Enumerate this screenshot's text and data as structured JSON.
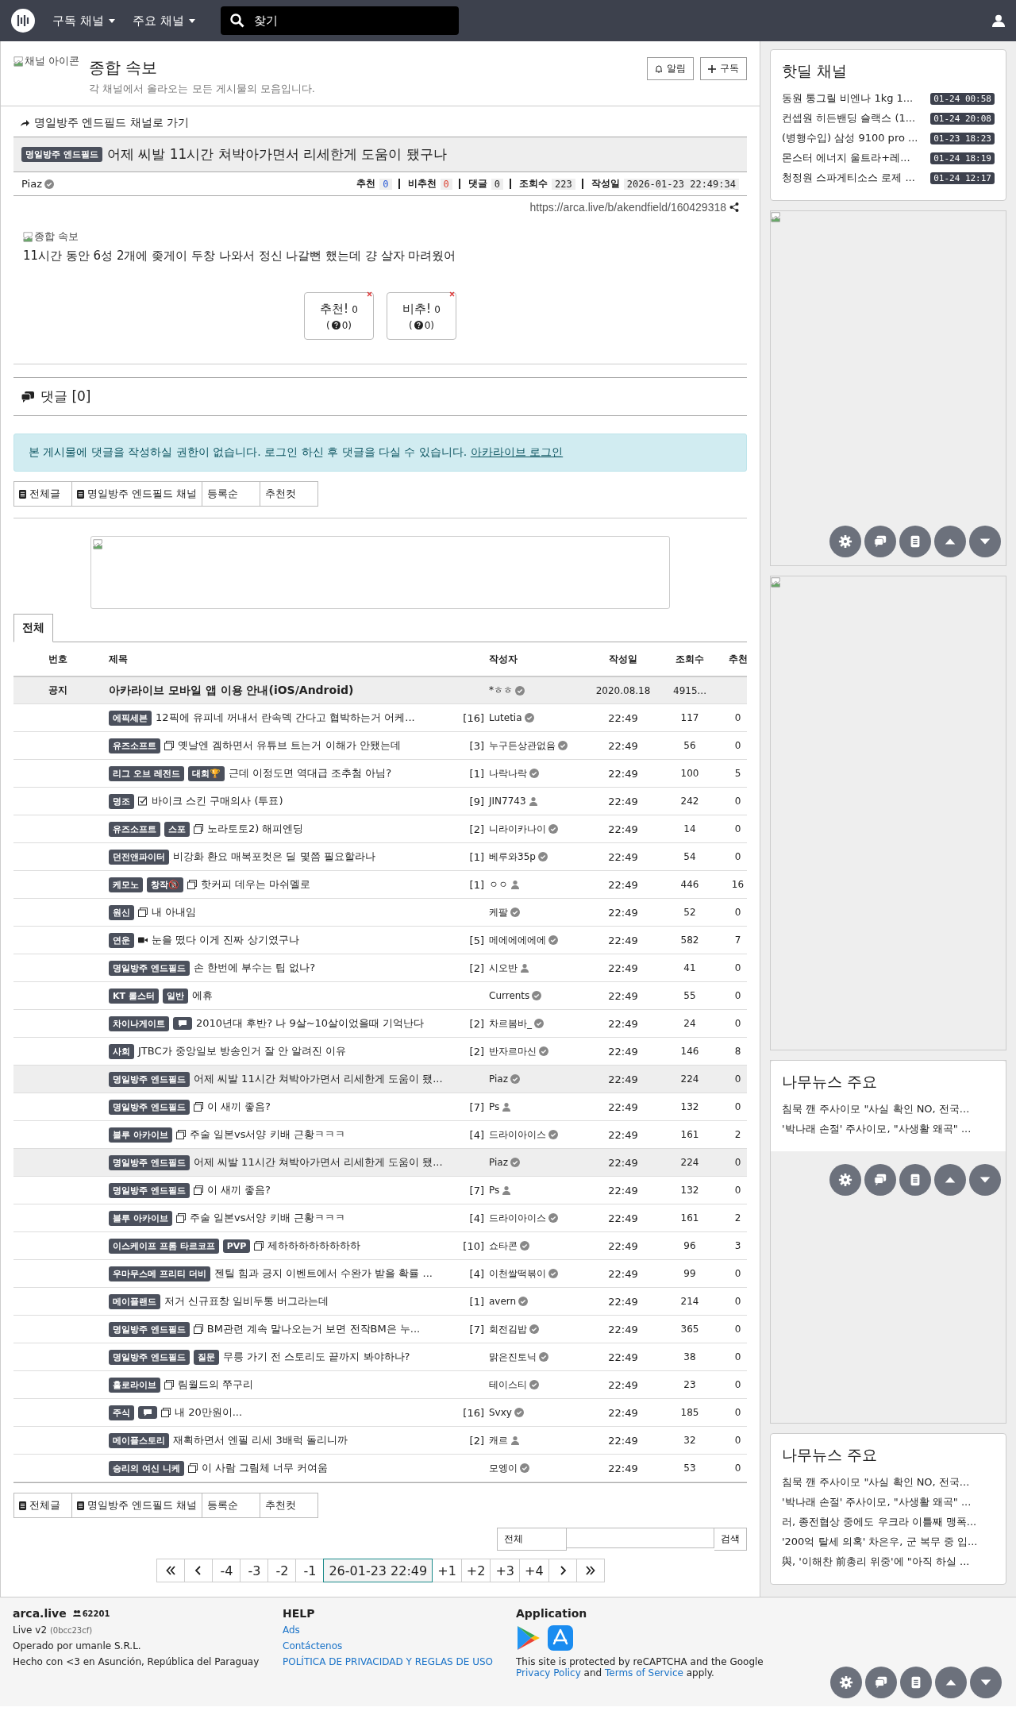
{
  "nav": {
    "menus": [
      "구독 채널",
      "주요 채널"
    ],
    "search": {
      "placeholder": "찾기"
    }
  },
  "channel": {
    "icon_alt": "채널 아이콘",
    "title": "종합 속보",
    "description": "각 채널에서 올라오는 모든 게시물의 모음입니다.",
    "buttons": [
      "알림",
      "구독"
    ]
  },
  "post": {
    "back_link": "명일방주 엔드필드 채널로 가기",
    "category": "명일방주 엔드필드",
    "title": "어제 씨발 11시간 쳐박아가면서 리세한게 도움이 됐구나",
    "author": "Piaz",
    "stats": [
      {
        "label": "추천",
        "value": "0",
        "kind": "up"
      },
      {
        "label": "비추천",
        "value": "0",
        "kind": "down"
      },
      {
        "label": "댓글",
        "value": "0",
        "kind": "plain"
      },
      {
        "label": "조회수",
        "value": "223",
        "kind": "plain"
      },
      {
        "label": "작성일",
        "value": "2026-01-23 22:49:34",
        "kind": "plain"
      }
    ],
    "url": "https://arca.live/b/akendfield/160429318",
    "image_alt": "종합 속보",
    "body": "11시간 동안 6성 2개에 좆게이 두창 나와서 정신 나갈뻔 했는데 걍 살자 마려웠어",
    "votes": [
      {
        "label": "추천!",
        "count": "0",
        "sub_open": "(",
        "sub": "0)"
      },
      {
        "label": "비추!",
        "count": "0",
        "sub_open": "(",
        "sub": "0)"
      }
    ]
  },
  "comments": {
    "title": "댓글 [0]",
    "notice": "본 게시물에 댓글을 작성하실 권한이 없습니다. 로그인 하신 후 댓글을 다실 수 있습니다.",
    "login_link": "아카라이브 로그인"
  },
  "filters_top": [
    {
      "label": "전체글",
      "kind": "board"
    },
    {
      "label": "명일방주 엔드필드 채널",
      "kind": "board"
    },
    {
      "label": "등록순",
      "kind": "sort"
    },
    {
      "label": "추천컷",
      "kind": "sort"
    }
  ],
  "tabs": [
    {
      "label": "전체",
      "selected": true
    }
  ],
  "table": {
    "columns": [
      "번호",
      "제목",
      "작성자",
      "작성일",
      "조회수",
      "추천"
    ],
    "notice": {
      "number": "공지",
      "title": "아카라이브 모바일 앱 이용 안내(iOS/Android)",
      "author": "*ㅎㅎ",
      "date": "2020.08.18",
      "views": "4915..."
    },
    "rows": [
      {
        "badges": [
          {
            "kind": "text",
            "text": "에픽세븐"
          }
        ],
        "kind": "plain",
        "title": "12픽에 유피네 꺼내서 란속덱 간다고 협박하는거 어케...",
        "comments": "[16]",
        "author": "Lutetia",
        "verified": true,
        "date": "22:49",
        "views": "117",
        "votes": "0",
        "current": false
      },
      {
        "badges": [
          {
            "kind": "text",
            "text": "유즈소프트"
          }
        ],
        "kind": "image",
        "title": "옛날엔 겜하면서 유튜브 트는거 이해가 안됐는데",
        "comments": "[3]",
        "author": "누구든상관없음",
        "verified": true,
        "date": "22:49",
        "views": "56",
        "votes": "0",
        "current": false
      },
      {
        "badges": [
          {
            "kind": "text",
            "text": "리그 오브 레전드"
          },
          {
            "kind": "text",
            "text": "대회🏆"
          }
        ],
        "kind": "plain",
        "title": "근데 이정도면 역대급 조추첨 아님?",
        "comments": "[1]",
        "author": "나락나락",
        "verified": true,
        "date": "22:49",
        "views": "100",
        "votes": "5",
        "current": false
      },
      {
        "badges": [
          {
            "kind": "text",
            "text": "명조"
          }
        ],
        "kind": "poll",
        "title": "바이크 스킨 구매의사 (투표)",
        "comments": "[9]",
        "author": "JIN7743",
        "verified": false,
        "date": "22:49",
        "views": "242",
        "votes": "0",
        "current": false
      },
      {
        "badges": [
          {
            "kind": "text",
            "text": "유즈소프트"
          },
          {
            "kind": "text",
            "text": "스포"
          }
        ],
        "kind": "image",
        "title": "노라토토2) 해피엔딩",
        "comments": "[2]",
        "author": "니라이카나이",
        "verified": true,
        "date": "22:49",
        "views": "14",
        "votes": "0",
        "current": false
      },
      {
        "badges": [
          {
            "kind": "text",
            "text": "던전앤파이터"
          }
        ],
        "kind": "plain",
        "title": "비강화 환요 매복포컷은 딜 몇쯤 필요할라나",
        "comments": "[1]",
        "author": "베루와35p",
        "verified": true,
        "date": "22:49",
        "views": "54",
        "votes": "0",
        "current": false
      },
      {
        "badges": [
          {
            "kind": "text",
            "text": "케모노"
          },
          {
            "kind": "text",
            "text": "창작🔞"
          }
        ],
        "kind": "image",
        "title": "핫커피 데우는 마쉬멜로",
        "comments": "[1]",
        "author": "ㅇㅇ",
        "verified": false,
        "date": "22:49",
        "views": "446",
        "votes": "16",
        "current": false
      },
      {
        "badges": [
          {
            "kind": "text",
            "text": "원신"
          }
        ],
        "kind": "image",
        "title": "내 아내임",
        "author": "케팔",
        "verified": true,
        "date": "22:49",
        "views": "52",
        "votes": "0",
        "current": false
      },
      {
        "badges": [
          {
            "kind": "text",
            "text": "연운"
          }
        ],
        "kind": "video",
        "title": "눈을 떴다 이게 진짜 상기였구나",
        "comments": "[5]",
        "author": "메에에에에에",
        "verified": true,
        "date": "22:49",
        "views": "582",
        "votes": "7",
        "current": false
      },
      {
        "badges": [
          {
            "kind": "text",
            "text": "명일방주 엔드필드"
          }
        ],
        "kind": "plain",
        "title": "손 한번에 부수는 팁 없나?",
        "comments": "[2]",
        "author": "시오반",
        "verified": false,
        "date": "22:49",
        "views": "41",
        "votes": "0",
        "current": false
      },
      {
        "badges": [
          {
            "kind": "text",
            "text": "KT 롤스터"
          },
          {
            "kind": "text",
            "text": "일반"
          }
        ],
        "kind": "plain",
        "title": "에휴",
        "author": "Currents",
        "verified": true,
        "date": "22:49",
        "views": "55",
        "votes": "0",
        "current": false
      },
      {
        "badges": [
          {
            "kind": "text",
            "text": "차이나게이트"
          },
          {
            "kind": "chat"
          }
        ],
        "kind": "plain",
        "title": "2010년대 후반? 나 9살~10살이었을때 기억난다",
        "comments": "[2]",
        "author": "차르봄바_",
        "verified": true,
        "date": "22:49",
        "views": "24",
        "votes": "0",
        "current": false
      },
      {
        "badges": [
          {
            "kind": "text",
            "text": "사회"
          }
        ],
        "kind": "plain",
        "title": "JTBC가 중앙일보 방송인거 잘 안 알려진 이유",
        "comments": "[2]",
        "author": "반자르마신",
        "verified": true,
        "date": "22:49",
        "views": "146",
        "votes": "8",
        "current": false
      },
      {
        "badges": [
          {
            "kind": "text",
            "text": "명일방주 엔드필드"
          }
        ],
        "kind": "plain",
        "title": "어제 씨발 11시간 쳐박아가면서 리세한게 도움이 됐...",
        "author": "Piaz",
        "verified": true,
        "date": "22:49",
        "views": "224",
        "votes": "0",
        "current": true
      },
      {
        "badges": [
          {
            "kind": "text",
            "text": "명일방주 엔드필드"
          }
        ],
        "kind": "image",
        "title": "이 새끼 좋음?",
        "comments": "[7]",
        "author": "Ps",
        "verified": false,
        "date": "22:49",
        "views": "132",
        "votes": "0",
        "current": false
      },
      {
        "badges": [
          {
            "kind": "text",
            "text": "블루 아카이브"
          }
        ],
        "kind": "image",
        "title": "주술 일본vs서양 키배 근황ㅋㅋㅋ",
        "comments": "[4]",
        "author": "드라이아이스",
        "verified": true,
        "date": "22:49",
        "views": "161",
        "votes": "2",
        "current": false
      },
      {
        "badges": [
          {
            "kind": "text",
            "text": "명일방주 엔드필드"
          }
        ],
        "kind": "plain",
        "title": "어제 씨발 11시간 쳐박아가면서 리세한게 도움이 됐...",
        "author": "Piaz",
        "verified": true,
        "date": "22:49",
        "views": "224",
        "votes": "0",
        "current": true
      },
      {
        "badges": [
          {
            "kind": "text",
            "text": "명일방주 엔드필드"
          }
        ],
        "kind": "image",
        "title": "이 새끼 좋음?",
        "comments": "[7]",
        "author": "Ps",
        "verified": false,
        "date": "22:49",
        "views": "132",
        "votes": "0",
        "current": false
      },
      {
        "badges": [
          {
            "kind": "text",
            "text": "블루 아카이브"
          }
        ],
        "kind": "image",
        "title": "주술 일본vs서양 키배 근황ㅋㅋㅋ",
        "comments": "[4]",
        "author": "드라이아이스",
        "verified": true,
        "date": "22:49",
        "views": "161",
        "votes": "2",
        "current": false
      },
      {
        "badges": [
          {
            "kind": "text",
            "text": "이스케이프 프롬 타르코프"
          },
          {
            "kind": "text",
            "text": "PVP"
          }
        ],
        "kind": "image",
        "title": "제하하하하하하하하",
        "comments": "[10]",
        "author": "쇼타콘",
        "verified": true,
        "date": "22:49",
        "views": "96",
        "votes": "3",
        "current": false
      },
      {
        "badges": [
          {
            "kind": "text",
            "text": "우마무스메 프리티 더비"
          }
        ],
        "kind": "plain",
        "title": "젠틸 힘과 긍지 이벤트에서 수완가 받을 확률 ...",
        "comments": "[4]",
        "author": "이천쌀떡볶이",
        "verified": true,
        "date": "22:49",
        "views": "99",
        "votes": "0",
        "current": false
      },
      {
        "badges": [
          {
            "kind": "text",
            "text": "메이플랜드"
          }
        ],
        "kind": "plain",
        "title": "저거 신규표창 일비두통 버그라는데",
        "comments": "[1]",
        "author": "avern",
        "verified": true,
        "date": "22:49",
        "views": "214",
        "votes": "0",
        "current": false
      },
      {
        "badges": [
          {
            "kind": "text",
            "text": "명일방주 엔드필드"
          }
        ],
        "kind": "image",
        "title": "BM관련 계속 말나오는거 보면 전작BM은 누...",
        "comments": "[7]",
        "author": "회전김밥",
        "verified": true,
        "date": "22:49",
        "views": "365",
        "votes": "0",
        "current": false
      },
      {
        "badges": [
          {
            "kind": "text",
            "text": "명일방주 엔드필드"
          },
          {
            "kind": "text",
            "text": "질문"
          }
        ],
        "kind": "plain",
        "title": "무릉 가기 전 스토리도 끝까지 봐야하나?",
        "author": "맑은진토닉",
        "verified": true,
        "date": "22:49",
        "views": "38",
        "votes": "0",
        "current": false
      },
      {
        "badges": [
          {
            "kind": "text",
            "text": "홀로라이브"
          }
        ],
        "kind": "image",
        "title": "림월드의 쭈구리",
        "author": "테이스티",
        "verified": true,
        "date": "22:49",
        "views": "23",
        "votes": "0",
        "current": false
      },
      {
        "badges": [
          {
            "kind": "text",
            "text": "주식"
          },
          {
            "kind": "chat"
          }
        ],
        "kind": "image",
        "title": "내 20만원이...",
        "comments": "[16]",
        "author": "Svxy",
        "verified": true,
        "date": "22:49",
        "views": "185",
        "votes": "0",
        "current": false
      },
      {
        "badges": [
          {
            "kind": "text",
            "text": "메이플스토리"
          }
        ],
        "kind": "plain",
        "title": "재획하면서 엔필 리세 3배럭 돌리니까",
        "comments": "[2]",
        "author": "캐르",
        "verified": false,
        "date": "22:49",
        "views": "32",
        "votes": "0",
        "current": false
      },
      {
        "badges": [
          {
            "kind": "text",
            "text": "승리의 여신 니케"
          }
        ],
        "kind": "image",
        "title": "이 사람 그림체 너무 커여움",
        "author": "모엥이",
        "verified": true,
        "date": "22:49",
        "views": "53",
        "votes": "0",
        "current": false
      }
    ]
  },
  "filters_bottom": [
    {
      "label": "전체글",
      "kind": "board"
    },
    {
      "label": "명일방주 엔드필드 채널",
      "kind": "board"
    },
    {
      "label": "등록순",
      "kind": "sort"
    },
    {
      "label": "추천컷",
      "kind": "sort"
    }
  ],
  "search": {
    "scope": "전체",
    "button": "검색"
  },
  "pagination": [
    {
      "label": "-4",
      "selected": false
    },
    {
      "label": "-3",
      "selected": false
    },
    {
      "label": "-2",
      "selected": false
    },
    {
      "label": "-1",
      "selected": false
    },
    {
      "label": "26-01-23 22:49",
      "selected": true
    },
    {
      "label": "+1",
      "selected": false
    },
    {
      "label": "+2",
      "selected": false
    },
    {
      "label": "+3",
      "selected": false
    },
    {
      "label": "+4",
      "selected": false
    }
  ],
  "sidebar": {
    "hotdeal": {
      "title": "핫딜 채널",
      "items": [
        {
          "text": "동원 통그릴 비엔나 1kg 1...",
          "time": "01-24 00:58"
        },
        {
          "text": "컨셉원 히든밴딩 슬랙스 (1...",
          "time": "01-24 20:08"
        },
        {
          "text": "(병행수입) 삼성 9100 pro ...",
          "time": "01-23 18:23"
        },
        {
          "text": "몬스터 에너지 울트라+레...",
          "time": "01-24 18:19"
        },
        {
          "text": "청정원 스파게티소스 로제 ...",
          "time": "01-24 12:17"
        }
      ]
    },
    "news": [
      {
        "title": "나무뉴스 주요",
        "items": [
          "침묵 깬 주사이모 \"사실 확인 NO, 전국...",
          "'박나래 손절' 주사이모, \"사생활 왜곡\" ..."
        ]
      },
      {
        "title": "나무뉴스 주요",
        "items": [
          "침묵 깬 주사이모 \"사실 확인 NO, 전국...",
          "'박나래 손절' 주사이모, \"사생활 왜곡\" ...",
          "러, 종전협상 중에도 우크라 이틀째 맹폭...",
          "'200억 탈세 의혹' 차은우, 군 복무 중 입...",
          "與, '이해찬 前총리 위중'에 \"아직 하실 ..."
        ]
      }
    ]
  },
  "footer": {
    "site": "arca.live",
    "users": "62201",
    "version": "Live v2",
    "build": "(0bcc23cf)",
    "operator": "Operado por umanle S.R.L.",
    "made": "Hecho con <3 en Asunción, República del Paraguay",
    "help_title": "HELP",
    "help_links": [
      "Ads",
      "Contáctenos",
      "POLÍTICA DE PRIVACIDAD Y REGLAS DE USO"
    ],
    "app_title": "Application",
    "recaptcha": [
      "This site is protected by reCAPTCHA and the Google ",
      "Privacy Policy",
      " and ",
      "Terms of Service",
      " apply."
    ]
  }
}
